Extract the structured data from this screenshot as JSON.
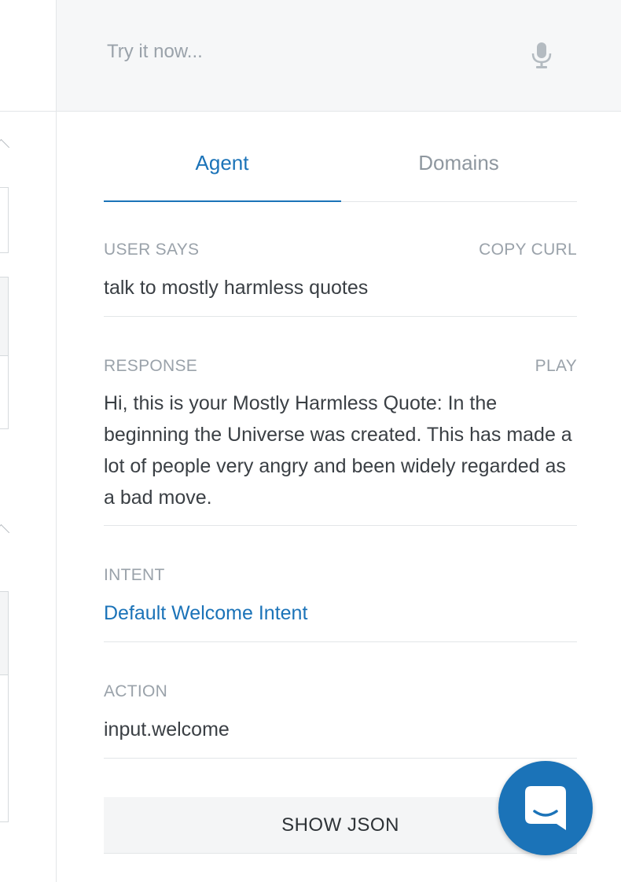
{
  "search": {
    "placeholder": "Try it now..."
  },
  "icons": {
    "mic": "microphone-icon",
    "chat": "chat-bubble-icon"
  },
  "tabs": [
    {
      "label": "Agent",
      "active": true
    },
    {
      "label": "Domains",
      "active": false
    }
  ],
  "user_says": {
    "label": "USER SAYS",
    "action": "COPY CURL",
    "value": "talk to mostly harmless quotes"
  },
  "response": {
    "label": "RESPONSE",
    "action": "PLAY",
    "value": "Hi, this is your Mostly Harmless Quote: In the beginning the Universe was created. This has made a lot of people very angry and been widely regarded as a bad move."
  },
  "intent": {
    "label": "INTENT",
    "value": "Default Welcome Intent"
  },
  "action": {
    "label": "ACTION",
    "value": "input.welcome"
  },
  "show_json": {
    "label": "SHOW JSON"
  },
  "colors": {
    "accent": "#1b73b8",
    "muted": "#9aa2aa",
    "text": "#3a3f44"
  }
}
